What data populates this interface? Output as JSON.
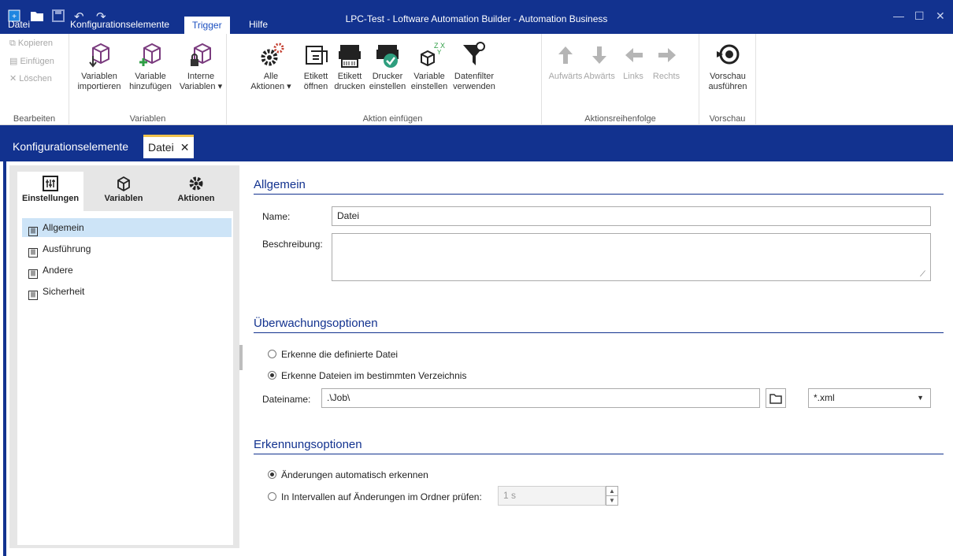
{
  "window": {
    "title": "LPC-Test - Loftware Automation Builder - Automation Business"
  },
  "menu": [
    "Datei",
    "Konfigurationselemente",
    "Trigger",
    "Hilfe"
  ],
  "ribbon": {
    "bearbeiten": {
      "kopieren": "Kopieren",
      "einfuegen": "Einfügen",
      "loeschen": "Löschen",
      "label": "Bearbeiten"
    },
    "variablen": {
      "importieren": [
        "Variablen",
        "importieren"
      ],
      "hinzufuegen": [
        "Variable",
        "hinzufügen"
      ],
      "interne": [
        "Interne",
        "Variablen ▾"
      ],
      "label": "Variablen"
    },
    "aktion": {
      "alle": [
        "Alle",
        "Aktionen ▾"
      ],
      "etikett_oeffnen": [
        "Etikett",
        "öffnen"
      ],
      "etikett_drucken": [
        "Etikett",
        "drucken"
      ],
      "drucker": [
        "Drucker",
        "einstellen"
      ],
      "variable": [
        "Variable",
        "einstellen"
      ],
      "datenfilter": [
        "Datenfilter",
        "verwenden"
      ],
      "label": "Aktion einfügen"
    },
    "reihenfolge": {
      "aufwaerts": "Aufwärts",
      "abwaerts": "Abwärts",
      "links": "Links",
      "rechts": "Rechts",
      "label": "Aktionsreihenfolge"
    },
    "vorschau": {
      "btn": [
        "Vorschau",
        "ausführen"
      ],
      "label": "Vorschau"
    }
  },
  "doctabs": {
    "inactive": "Konfigurationselemente",
    "active": "Datei",
    "close": "✕"
  },
  "sidetabs": [
    "Einstellungen",
    "Variablen",
    "Aktionen"
  ],
  "nav": [
    "Allgemein",
    "Ausführung",
    "Andere",
    "Sicherheit"
  ],
  "allgemein": {
    "title": "Allgemein",
    "name_label": "Name:",
    "name_value": "Datei",
    "beschreibung_label": "Beschreibung:",
    "beschreibung_value": ""
  },
  "ueberwachung": {
    "title": "Überwachungsoptionen",
    "opt1": "Erkenne die definierte Datei",
    "opt2": "Erkenne Dateien im bestimmten Verzeichnis",
    "selected": 2,
    "dateiname_label": "Dateiname:",
    "dateiname_value": ".\\Job\\",
    "filter_value": "*.xml"
  },
  "erkennung": {
    "title": "Erkennungsoptionen",
    "opt1": "Änderungen automatisch erkennen",
    "opt2": "In Intervallen auf Änderungen im Ordner prüfen:",
    "selected": 1,
    "interval_value": "1 s"
  },
  "colors": {
    "brand": "#12328f",
    "accent": "#f0c24d",
    "selection": "#cde4f7"
  }
}
